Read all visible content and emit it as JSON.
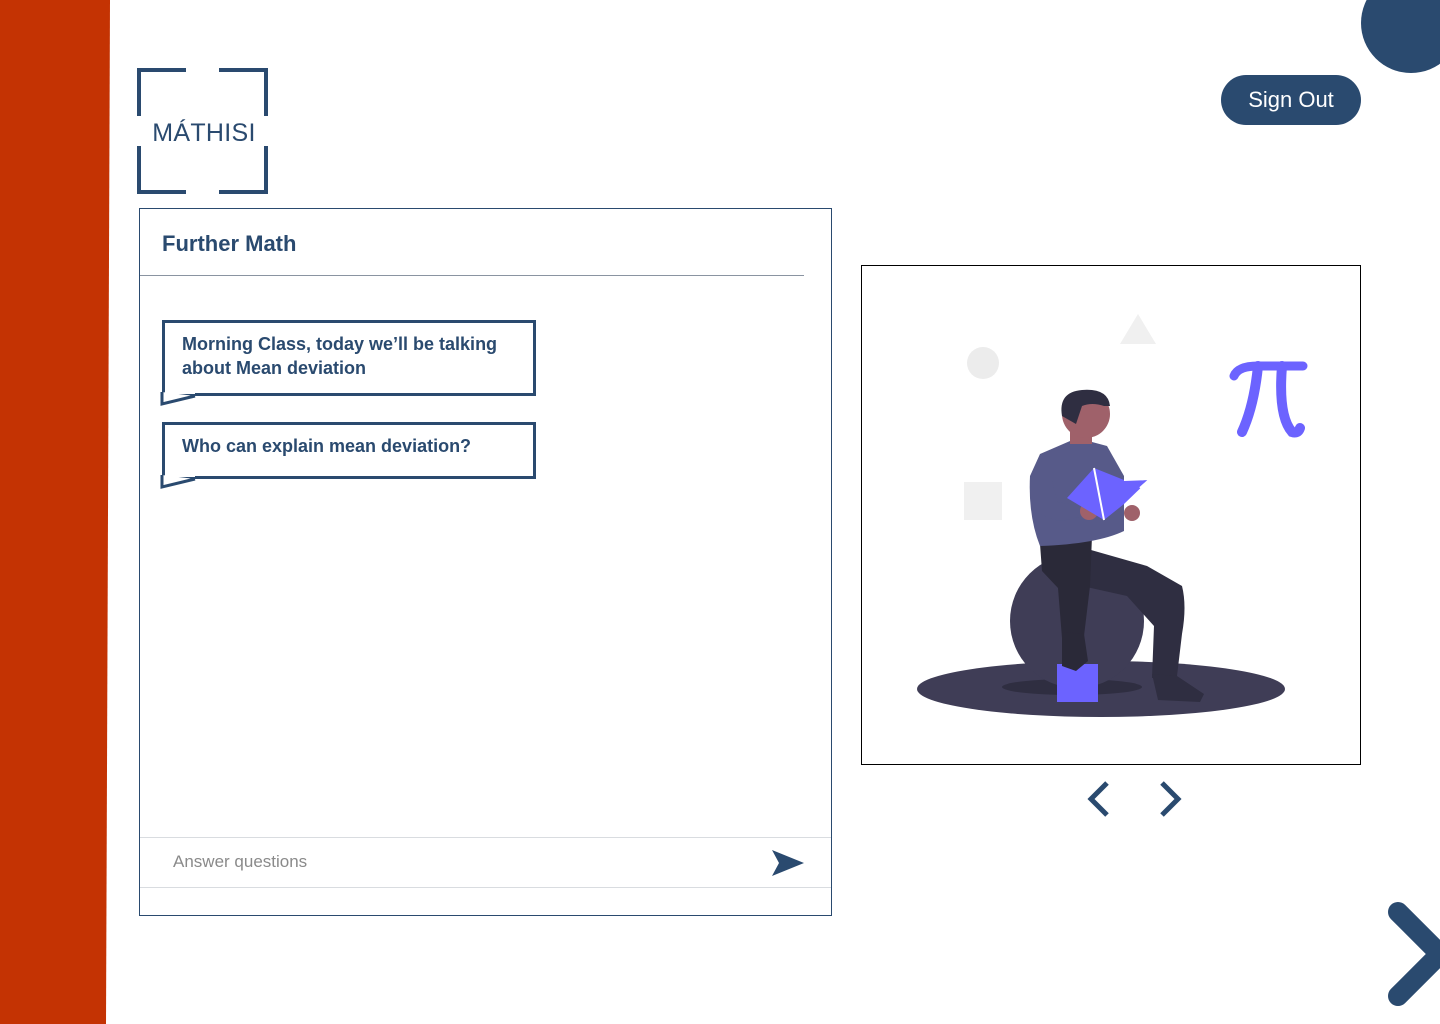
{
  "brand": {
    "logo_text": "MÁTHISI"
  },
  "header": {
    "sign_out_label": "Sign Out"
  },
  "chat": {
    "title": "Further Math",
    "messages": [
      {
        "text": "Morning Class, today we’ll be talking about Mean deviation"
      },
      {
        "text": "Who can explain mean deviation?"
      }
    ],
    "answer_placeholder": "Answer questions"
  },
  "icons": {
    "send": "send-icon",
    "prev": "chevron-left-icon",
    "next": "chevron-right-icon",
    "page_next": "chevron-right-icon"
  },
  "colors": {
    "sidebar": "#c43303",
    "primary": "#2a4a6f",
    "accent": "#6c63ff"
  }
}
